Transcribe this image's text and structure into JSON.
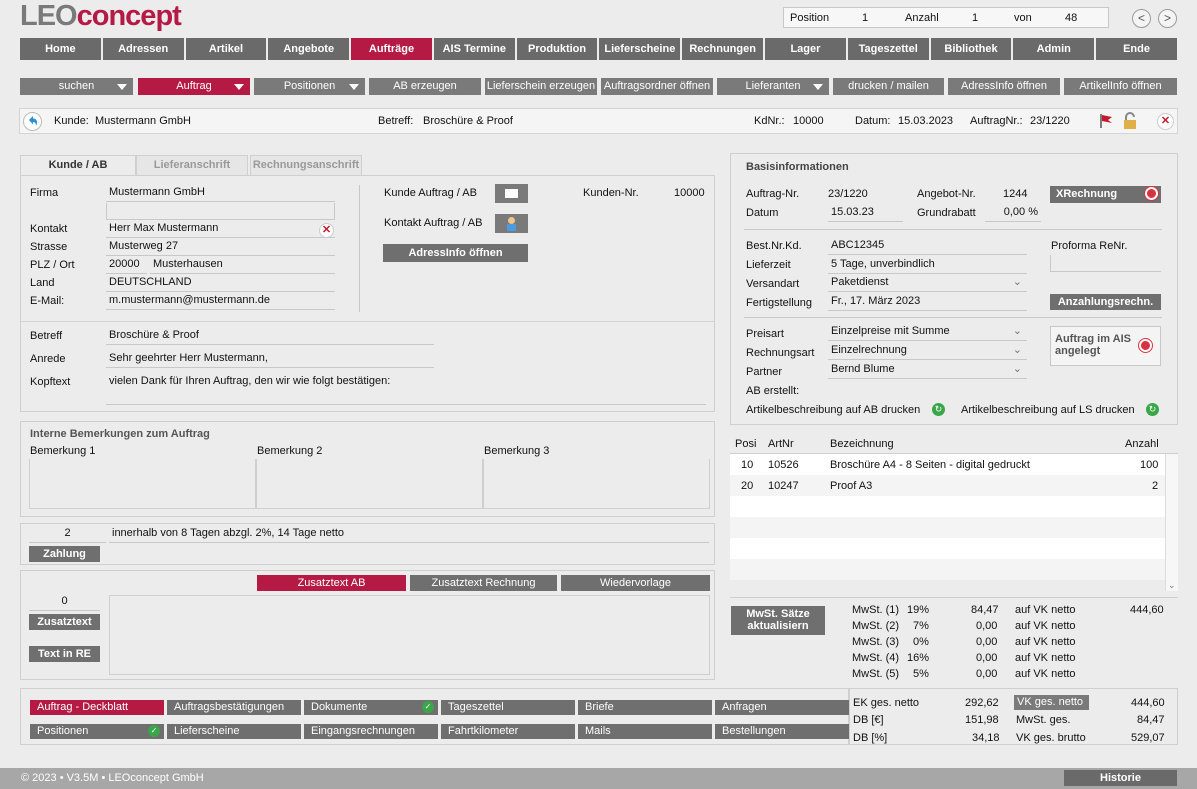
{
  "logo": {
    "part1": "LEO",
    "part2": "concept"
  },
  "position": {
    "label": "Position",
    "value": "1",
    "anzahl_label": "Anzahl",
    "anzahl": "1",
    "von_label": "von",
    "total": "48"
  },
  "nav": {
    "prev": "<",
    "next": ">",
    "items": [
      "Home",
      "Adressen",
      "Artikel",
      "Angebote",
      "Aufträge",
      "AIS Termine",
      "Produktion",
      "Lieferscheine",
      "Rechnungen",
      "Lager",
      "Tageszettel",
      "Bibliothek",
      "Admin",
      "Ende"
    ]
  },
  "toolbar": {
    "suchen": "suchen",
    "auftrag": "Auftrag",
    "positionen": "Positionen",
    "ab_erzeugen": "AB erzeugen",
    "lieferschein": "Lieferschein erzeugen",
    "ordner": "Auftragsordner öffnen",
    "lieferanten": "Lieferanten",
    "drucken": "drucken / mailen",
    "adressinfo": "AdressInfo öffnen",
    "artikelinfo": "ArtikelInfo öffnen"
  },
  "infobar": {
    "kunde_label": "Kunde:",
    "kunde": "Mustermann GmbH",
    "betreff_label": "Betreff:",
    "betreff": "Broschüre & Proof",
    "kdnr_label": "KdNr.:",
    "kdnr": "10000",
    "datum_label": "Datum:",
    "datum": "15.03.2023",
    "auftragnr_label": "AuftragNr.:",
    "auftragnr": "23/1220"
  },
  "tabs": [
    "Kunde / AB",
    "Lieferanschrift",
    "Rechnungsanschrift"
  ],
  "kunde": {
    "firma_label": "Firma",
    "firma": "Mustermann GmbH",
    "kontakt_label": "Kontakt",
    "kontakt": "Herr Max Mustermann",
    "strasse_label": "Strasse",
    "strasse": "Musterweg 27",
    "plz_label": "PLZ / Ort",
    "plz": "20000",
    "ort": "Musterhausen",
    "land_label": "Land",
    "land": "DEUTSCHLAND",
    "email_label": "E-Mail:",
    "email": "m.mustermann@mustermann.de",
    "kunde_ab_label": "Kunde Auftrag / AB",
    "kontakt_ab_label": "Kontakt Auftrag / AB",
    "kundennr_label": "Kunden-Nr.",
    "kundennr": "10000",
    "adressinfo_btn": "AdressInfo öffnen",
    "betreff_label": "Betreff",
    "betreff": "Broschüre & Proof",
    "anrede_label": "Anrede",
    "anrede": "Sehr geehrter Herr Mustermann,",
    "kopftext_label": "Kopftext",
    "kopftext": "vielen Dank für Ihren Auftrag, den wir wie folgt bestätigen:"
  },
  "bemerkungen": {
    "title": "Interne Bemerkungen zum Auftrag",
    "b1": "Bemerkung 1",
    "b2": "Bemerkung 2",
    "b3": "Bemerkung 3"
  },
  "zahlung": {
    "tage": "2",
    "text": "innerhalb von 8 Tagen abzgl. 2%, 14 Tage netto",
    "btn": "Zahlung"
  },
  "zusatz": {
    "ab": "Zusatztext AB",
    "rechnung": "Zusatztext Rechnung",
    "wiedervorlage": "Wiedervorlage",
    "count": "0",
    "btn": "Zusatztext",
    "re_btn": "Text in RE"
  },
  "basis": {
    "title": "Basisinformationen",
    "auftragnr_label": "Auftrag-Nr.",
    "auftragnr": "23/1220",
    "angebotnr_label": "Angebot-Nr.",
    "angebotnr": "1244",
    "xrechnung": "XRechnung",
    "datum_label": "Datum",
    "datum": "15.03.23",
    "grundrabatt_label": "Grundrabatt",
    "grundrabatt": "0,00 %",
    "bestnr_label": "Best.Nr.Kd.",
    "bestnr": "ABC12345",
    "proforma_label": "Proforma ReNr.",
    "lieferzeit_label": "Lieferzeit",
    "lieferzeit": "5 Tage, unverbindlich",
    "versandart_label": "Versandart",
    "versandart": "Paketdienst",
    "fertig_label": "Fertigstellung",
    "fertig": "Fr., 17. März 2023",
    "anzahlung_btn": "Anzahlungsrechn.",
    "preisart_label": "Preisart",
    "preisart": "Einzelpreise mit Summe",
    "rechnungsart_label": "Rechnungsart",
    "rechnungsart": "Einzelrechnung",
    "partner_label": "Partner",
    "partner": "Bernd Blume",
    "ab_erstellt_label": "AB erstellt:",
    "ais_btn": "Auftrag im AIS angelegt",
    "art_ab": "Artikelbeschreibung auf AB drucken",
    "art_ls": "Artikelbeschreibung auf LS drucken"
  },
  "positions": {
    "headers": [
      "Posi",
      "ArtNr",
      "Bezeichnung",
      "Anzahl"
    ],
    "rows": [
      [
        "10",
        "10526",
        "Broschüre A4 - 8 Seiten - digital gedruckt",
        "100"
      ],
      [
        "20",
        "10247",
        "Proof A3",
        "2"
      ]
    ]
  },
  "mwst": {
    "btn": "MwSt. Sätze aktualisiern",
    "rows": [
      [
        "MwSt. (1)",
        "19%",
        "84,47",
        "auf VK netto"
      ],
      [
        "MwSt. (2)",
        "7%",
        "0,00",
        "auf VK netto"
      ],
      [
        "MwSt. (3)",
        "0%",
        "0,00",
        "auf VK netto"
      ],
      [
        "MwSt. (4)",
        "16%",
        "0,00",
        "auf VK netto"
      ],
      [
        "MwSt. (5)",
        "5%",
        "0,00",
        "auf VK netto"
      ]
    ],
    "vk_netto_top": "444,60"
  },
  "summen": {
    "ek_label": "EK ges. netto",
    "ek": "292,62",
    "db_label": "DB [€]",
    "db": "151,98",
    "dbp_label": "DB [%]",
    "dbp": "34,18",
    "vk_label": "VK ges. netto",
    "vk": "444,60",
    "mwst_label": "MwSt. ges.",
    "mwst": "84,47",
    "brutto_label": "VK ges. brutto",
    "brutto": "529,07"
  },
  "bottom": {
    "row1": [
      "Auftrag - Deckblatt",
      "Auftragsbestätigungen",
      "Dokumente",
      "Tageszettel",
      "Briefe",
      "Anfragen"
    ],
    "row2": [
      "Positionen",
      "Lieferscheine",
      "Eingangsrechnungen",
      "Fahrtkilometer",
      "Mails",
      "Bestellungen"
    ]
  },
  "footer": {
    "text": "© 2023 • V3.5M • LEOconcept GmbH",
    "historie": "Historie"
  }
}
